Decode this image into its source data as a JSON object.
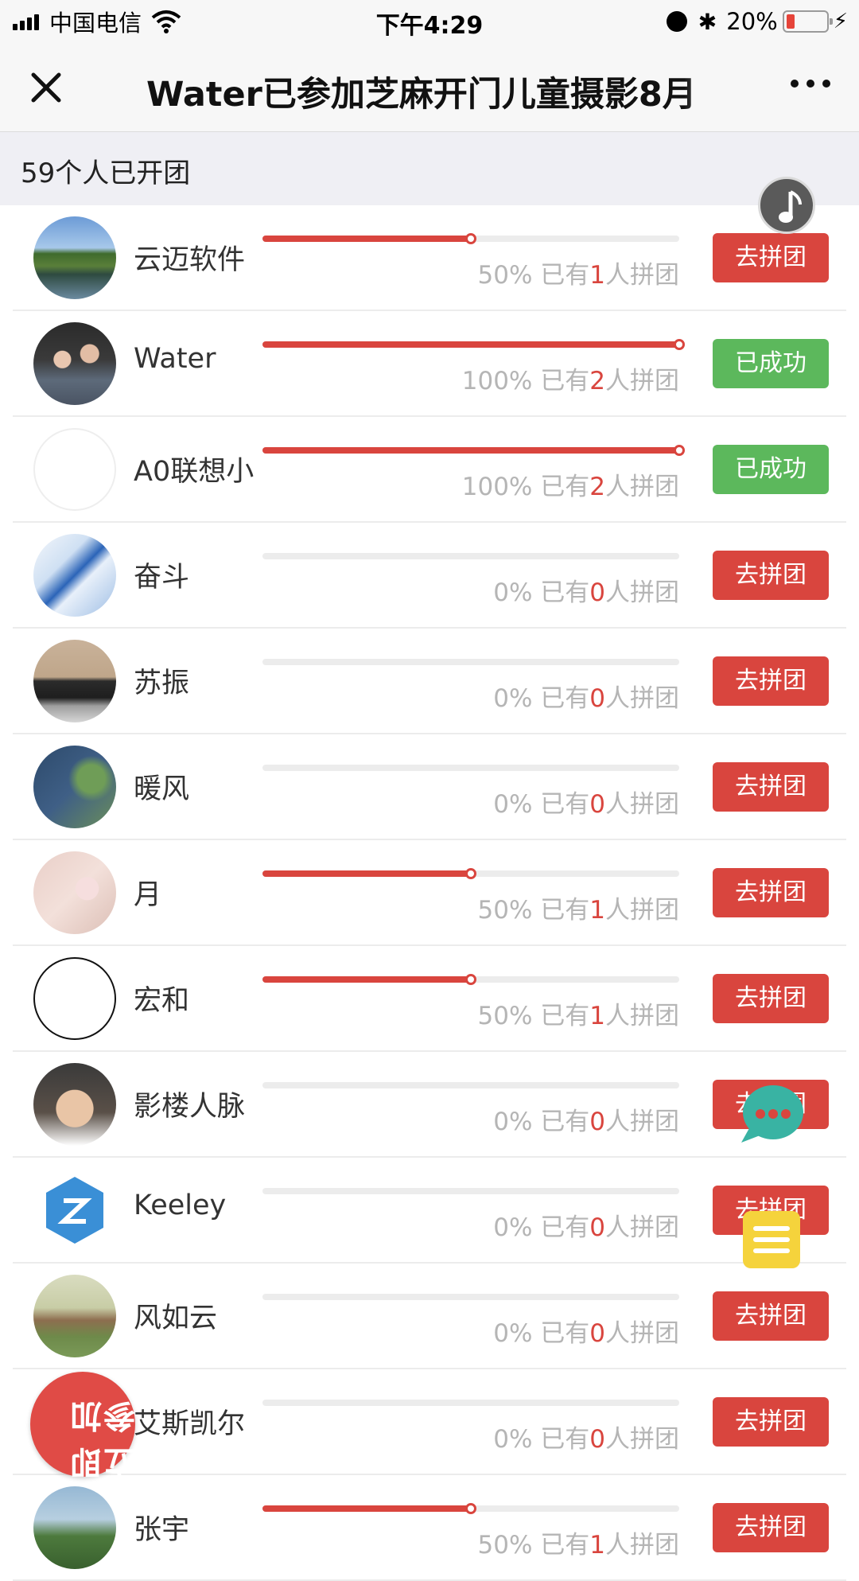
{
  "status_bar": {
    "carrier": "中国电信",
    "time": "下午4:29",
    "battery_percent": "20%",
    "battery_level": 0.2
  },
  "navbar": {
    "title": "Water已参加芝麻开门儿童摄影8月",
    "close_icon": "close-icon",
    "more_icon": "more-icon"
  },
  "summary": {
    "count_text": "59个人已开团"
  },
  "colors": {
    "accent_red": "#d9453e",
    "success_green": "#5cb85c",
    "muted_text": "#b5b5b5"
  },
  "participants": [
    {
      "name": "云迈软件",
      "percent": 50,
      "percent_text": "50%",
      "prefix": "已有",
      "joined": "1",
      "suffix": "人拼团",
      "button": "去拼团",
      "status": "open"
    },
    {
      "name": "Water",
      "percent": 100,
      "percent_text": "100%",
      "prefix": "已有",
      "joined": "2",
      "suffix": "人拼团",
      "button": "已成功",
      "status": "success"
    },
    {
      "name": "A0联想小",
      "percent": 100,
      "percent_text": "100%",
      "prefix": "已有",
      "joined": "2",
      "suffix": "人拼团",
      "button": "已成功",
      "status": "success"
    },
    {
      "name": "奋斗",
      "percent": 0,
      "percent_text": "0%",
      "prefix": "已有",
      "joined": "0",
      "suffix": "人拼团",
      "button": "去拼团",
      "status": "open"
    },
    {
      "name": "苏振",
      "percent": 0,
      "percent_text": "0%",
      "prefix": "已有",
      "joined": "0",
      "suffix": "人拼团",
      "button": "去拼团",
      "status": "open"
    },
    {
      "name": "暖风",
      "percent": 0,
      "percent_text": "0%",
      "prefix": "已有",
      "joined": "0",
      "suffix": "人拼团",
      "button": "去拼团",
      "status": "open"
    },
    {
      "name": "月",
      "percent": 50,
      "percent_text": "50%",
      "prefix": "已有",
      "joined": "1",
      "suffix": "人拼团",
      "button": "去拼团",
      "status": "open"
    },
    {
      "name": "宏和",
      "percent": 50,
      "percent_text": "50%",
      "prefix": "已有",
      "joined": "1",
      "suffix": "人拼团",
      "button": "去拼团",
      "status": "open"
    },
    {
      "name": "影楼人脉",
      "percent": 0,
      "percent_text": "0%",
      "prefix": "已有",
      "joined": "0",
      "suffix": "人拼团",
      "button": "去拼团",
      "status": "open"
    },
    {
      "name": "Keeley",
      "percent": 0,
      "percent_text": "0%",
      "prefix": "已有",
      "joined": "0",
      "suffix": "人拼团",
      "button": "去拼团",
      "status": "open"
    },
    {
      "name": "风如云",
      "percent": 0,
      "percent_text": "0%",
      "prefix": "已有",
      "joined": "0",
      "suffix": "人拼团",
      "button": "去拼团",
      "status": "open"
    },
    {
      "name": "艾斯凯尔",
      "percent": 0,
      "percent_text": "0%",
      "prefix": "已有",
      "joined": "0",
      "suffix": "人拼团",
      "button": "去拼团",
      "status": "open"
    },
    {
      "name": "张宇",
      "percent": 50,
      "percent_text": "50%",
      "prefix": "已有",
      "joined": "1",
      "suffix": "人拼团",
      "button": "去拼团",
      "status": "open"
    }
  ],
  "floating": {
    "music_icon": "music-note-icon",
    "chat_icon": "chat-bubble-icon",
    "note_icon": "note-list-icon",
    "join_stamp_text": "立即参加"
  }
}
